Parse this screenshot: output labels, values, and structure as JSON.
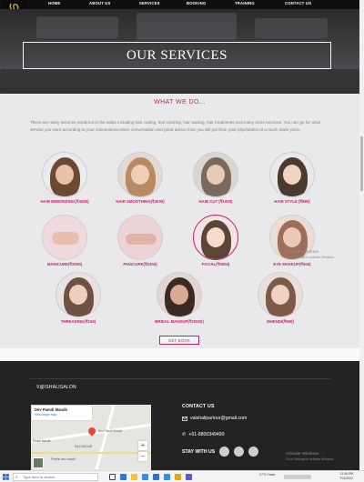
{
  "nav": {
    "items": [
      "HOME",
      "ABOUT US",
      "SERVICES",
      "BOOKING",
      "TRAINING",
      "CONTACT US"
    ]
  },
  "hero": {
    "title": "OUR SERVICES"
  },
  "services": {
    "heading": "WHAT WE DO...",
    "intro": "There are many services rendered in the salon including hair cutting, hair coloring, hair waxing, hair treatments and many more services. You can go for what service you want according to your convenience.More conversation and good advice than you will get from your psychiatrist at a much lower price.",
    "items": [
      {
        "label": "HAIR REBONDING(₹4000)"
      },
      {
        "label": "HAIR SMOOTHING(₹4000)"
      },
      {
        "label": "HAIR CUT (₹1000)"
      },
      {
        "label": "HAIR STYLE (₹880)"
      },
      {
        "label": "MANICURE(₹2000)"
      },
      {
        "label": "PADICURE(₹2300)"
      },
      {
        "label": "FACIAL(₹5000)"
      },
      {
        "label": "EYE MAKEUP(₹500)"
      },
      {
        "label": "THREADING(₹150)"
      },
      {
        "label": "BRIDAL MAKEUP(₹20000)"
      },
      {
        "label": "MHENDI(₹550)"
      }
    ],
    "book_label": "GET BOOK"
  },
  "footer": {
    "brand": "V@ISHALISALON",
    "map": {
      "place": "Dev Pamdi Mandir",
      "link": "View larger map",
      "labels": [
        "Shaktl Mandir",
        "Dev Pamdi Mandir",
        "RAJI NAGAR",
        "Prabhu dev mandir"
      ]
    },
    "contact_heading": "CONTACT US",
    "email": "vaishaliparlour@gmail.com",
    "phone": "+91-8800349499",
    "stay_label": "STAY WITH US"
  },
  "watermarks": [
    {
      "title": "Activate Windows",
      "sub": "Go to Settings to activate Windows."
    },
    {
      "title": "Activate Windows",
      "sub": "Go to Settings to activate Windows."
    }
  ],
  "taskbar": {
    "search_placeholder": "Type here to search",
    "weather": "27°C Haze",
    "time": "12:46 PM",
    "date": "7/11/2022"
  },
  "colors": {
    "accent": "#c81e69",
    "footer_bg": "#232323",
    "nav_bg": "#101010"
  }
}
